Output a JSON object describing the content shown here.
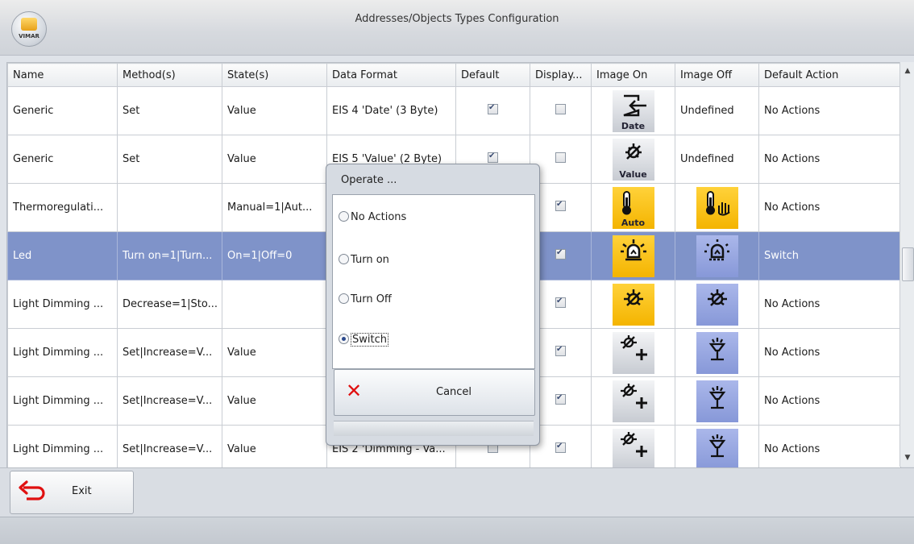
{
  "window": {
    "title": "Addresses/Objects Types Configuration",
    "logo_text": "VIMAR"
  },
  "columns": [
    "Name",
    "Method(s)",
    "State(s)",
    "Data Format",
    "Default",
    "Display...",
    "Image On",
    "Image Off",
    "Default Action"
  ],
  "rows": [
    {
      "name": "Generic",
      "methods": "Set",
      "states": "Value",
      "format": "EIS 4 'Date' (3 Byte)",
      "default": true,
      "display": false,
      "on_icon": "date-import-icon",
      "on_label": "Date",
      "off_text": "Undefined",
      "action": "No Actions"
    },
    {
      "name": "Generic",
      "methods": "Set",
      "states": "Value",
      "format": "EIS 5 'Value' (2 Byte)",
      "default": true,
      "display": false,
      "on_icon": "value-lamp-icon",
      "on_label": "Value",
      "off_text": "Undefined",
      "action": "No Actions"
    },
    {
      "name": "Thermoregulati...",
      "methods": "",
      "states": "Manual=1|Aut...",
      "format": "",
      "default": false,
      "display": true,
      "on_icon": "thermometer-icon",
      "on_label": "Auto",
      "off_icon": "thermometer-hand-icon",
      "off_text": "",
      "action": "No Actions"
    },
    {
      "name": "Led",
      "methods": "Turn on=1|Turn...",
      "states": "On=1|Off=0",
      "format": "",
      "default": false,
      "display": true,
      "on_icon": "led-on-icon",
      "on_label": "",
      "off_icon": "led-off-icon",
      "off_text": "",
      "action": "Switch",
      "selected": true
    },
    {
      "name": "Light Dimming ...",
      "methods": "Decrease=1|Sto...",
      "states": "",
      "format": "",
      "default": false,
      "display": true,
      "on_icon": "dimmer-lamp-icon",
      "on_label": "",
      "off_icon": "dimmer-lamp-icon",
      "off_text": "",
      "action": "No Actions"
    },
    {
      "name": "Light Dimming ...",
      "methods": "Set|Increase=V...",
      "states": "Value",
      "format": "",
      "default": false,
      "display": true,
      "on_icon": "lamp-plus-icon",
      "on_label": "",
      "off_icon": "ceiling-lamp-icon",
      "off_text": "",
      "action": "No Actions"
    },
    {
      "name": "Light Dimming ...",
      "methods": "Set|Increase=V...",
      "states": "Value",
      "format": "",
      "default": false,
      "display": true,
      "on_icon": "lamp-plus-icon",
      "on_label": "",
      "off_icon": "ceiling-lamp-icon",
      "off_text": "",
      "action": "No Actions"
    },
    {
      "name": "Light Dimming ...",
      "methods": "Set|Increase=V...",
      "states": "Value",
      "format": "EIS 2 'Dimming - Va...",
      "default": false,
      "display": true,
      "on_icon": "lamp-plus-icon",
      "on_label": "",
      "off_icon": "ceiling-lamp-icon",
      "off_text": "",
      "action": "No Actions"
    }
  ],
  "dialog": {
    "title": "Operate ...",
    "options": [
      "No Actions",
      "Turn on",
      "Turn Off",
      "Switch"
    ],
    "selected": "Switch",
    "cancel_label": "Cancel"
  },
  "footer": {
    "exit_label": "Exit"
  },
  "colors": {
    "selected_row": "#7f93c9",
    "icon_on_bg": "#f4b400",
    "icon_off_bg": "#8798d8",
    "cancel_x": "#e01010",
    "exit_arrow": "#e01010"
  }
}
